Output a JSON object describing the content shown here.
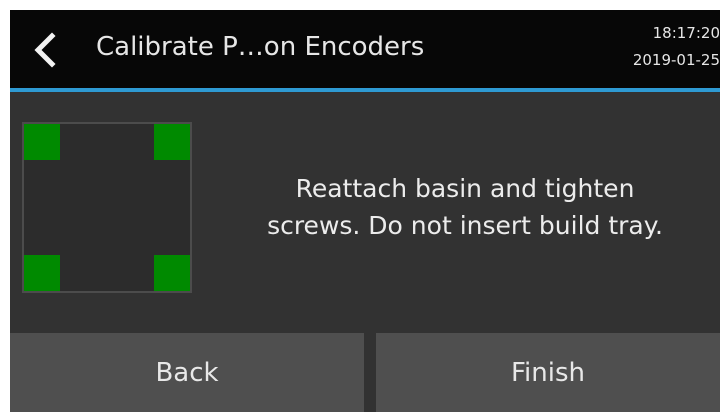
{
  "header": {
    "title": "Calibrate P…on Encoders",
    "time": "18:17:20",
    "date": "2019-01-25"
  },
  "main": {
    "message_line1": "Reattach basin and tighten",
    "message_line2": "screws. Do not insert build tray."
  },
  "buttons": {
    "back_label": "Back",
    "finish_label": "Finish"
  },
  "icons": {
    "back": "chevron-left-icon",
    "basin": "basin-diagram"
  },
  "colors": {
    "background": "#323232",
    "header": "#070707",
    "accent_line": "#2e9ad3",
    "screw": "#008a00",
    "button": "#4f4f4f",
    "text": "#e6e6e6"
  }
}
